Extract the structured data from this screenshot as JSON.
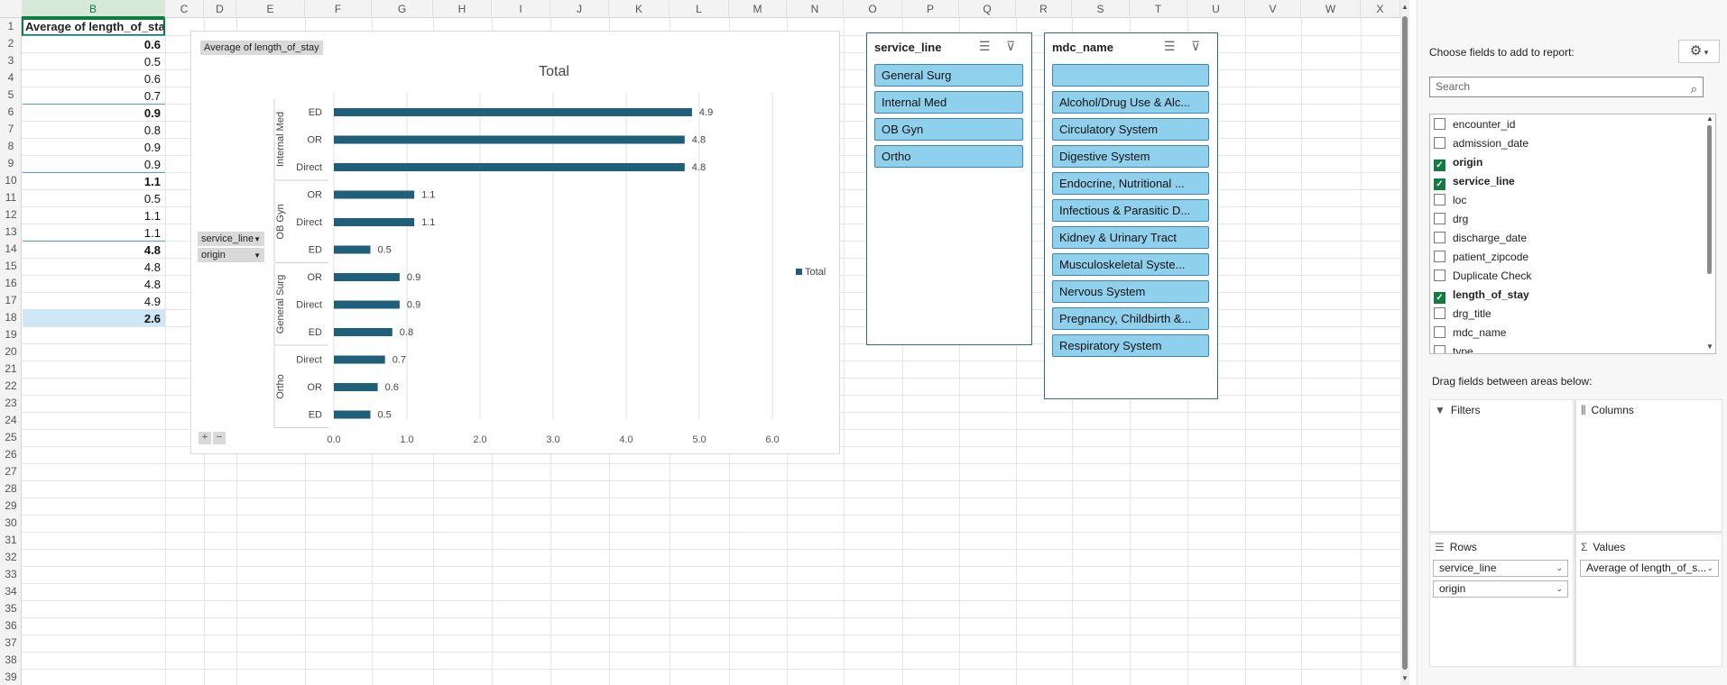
{
  "columns": [
    "B",
    "C",
    "D",
    "E",
    "F",
    "G",
    "H",
    "I",
    "J",
    "K",
    "L",
    "M",
    "N",
    "O",
    "P",
    "Q",
    "R",
    "S",
    "T",
    "U",
    "V",
    "W",
    "X"
  ],
  "rows": [
    "1",
    "2",
    "3",
    "4",
    "5",
    "6",
    "7",
    "8",
    "9",
    "10",
    "11",
    "12",
    "13",
    "14",
    "15",
    "16",
    "17",
    "18",
    "19",
    "20",
    "21",
    "22",
    "23",
    "24",
    "25",
    "26",
    "27",
    "28",
    "29",
    "30",
    "31",
    "32",
    "33",
    "34",
    "35",
    "36",
    "37",
    "38",
    "39"
  ],
  "pivot": {
    "header": "Average of length_of_stay",
    "values": [
      {
        "v": "0.6",
        "bold": true
      },
      {
        "v": "0.5",
        "bold": false
      },
      {
        "v": "0.6",
        "bold": false
      },
      {
        "v": "0.7",
        "bold": false
      },
      {
        "v": "0.9",
        "bold": true
      },
      {
        "v": "0.8",
        "bold": false
      },
      {
        "v": "0.9",
        "bold": false
      },
      {
        "v": "0.9",
        "bold": false
      },
      {
        "v": "1.1",
        "bold": true
      },
      {
        "v": "0.5",
        "bold": false
      },
      {
        "v": "1.1",
        "bold": false
      },
      {
        "v": "1.1",
        "bold": false
      },
      {
        "v": "4.8",
        "bold": true
      },
      {
        "v": "4.8",
        "bold": false
      },
      {
        "v": "4.8",
        "bold": false
      },
      {
        "v": "4.9",
        "bold": false
      },
      {
        "v": "2.6",
        "bold": true
      }
    ]
  },
  "chart": {
    "field_button": "Average of length_of_stay",
    "row_fields": [
      "service_line",
      "origin"
    ],
    "plus": "+",
    "minus": "−"
  },
  "chart_data": {
    "type": "bar",
    "orientation": "horizontal",
    "title": "Total",
    "groups": [
      {
        "name": "Internal Med",
        "items": [
          {
            "label": "ED",
            "value": 4.9
          },
          {
            "label": "OR",
            "value": 4.8
          },
          {
            "label": "Direct",
            "value": 4.8
          }
        ]
      },
      {
        "name": "OB Gyn",
        "items": [
          {
            "label": "OR",
            "value": 1.1
          },
          {
            "label": "Direct",
            "value": 1.1
          },
          {
            "label": "ED",
            "value": 0.5
          }
        ]
      },
      {
        "name": "General Surg",
        "items": [
          {
            "label": "OR",
            "value": 0.9
          },
          {
            "label": "Direct",
            "value": 0.9
          },
          {
            "label": "ED",
            "value": 0.8
          }
        ]
      },
      {
        "name": "Ortho",
        "items": [
          {
            "label": "Direct",
            "value": 0.7
          },
          {
            "label": "OR",
            "value": 0.6
          },
          {
            "label": "ED",
            "value": 0.5
          }
        ]
      }
    ],
    "xticks": [
      "0.0",
      "1.0",
      "2.0",
      "3.0",
      "4.0",
      "5.0",
      "6.0"
    ],
    "xlim": [
      0,
      6.5
    ],
    "legend": {
      "label": "Total",
      "position": "right"
    },
    "bar_color": "#1f5f7a",
    "grid": true
  },
  "slicer_service": {
    "title": "service_line",
    "items": [
      "General Surg",
      "Internal Med",
      "OB Gyn",
      "Ortho"
    ]
  },
  "slicer_mdc": {
    "title": "mdc_name",
    "items": [
      "",
      "Alcohol/Drug Use & Alc...",
      "Circulatory System",
      "Digestive System",
      "Endocrine, Nutritional ...",
      "Infectious & Parasitic D...",
      "Kidney & Urinary Tract",
      "Musculoskeletal Syste...",
      "Nervous System",
      "Pregnancy, Childbirth &...",
      "Respiratory System"
    ]
  },
  "pane": {
    "choose_label": "Choose fields to add to report:",
    "search_placeholder": "Search",
    "fields": [
      {
        "name": "encounter_id",
        "checked": false
      },
      {
        "name": "admission_date",
        "checked": false
      },
      {
        "name": "origin",
        "checked": true
      },
      {
        "name": "service_line",
        "checked": true
      },
      {
        "name": "loc",
        "checked": false
      },
      {
        "name": "drg",
        "checked": false
      },
      {
        "name": "discharge_date",
        "checked": false
      },
      {
        "name": "patient_zipcode",
        "checked": false
      },
      {
        "name": "Duplicate Check",
        "checked": false
      },
      {
        "name": "length_of_stay",
        "checked": true
      },
      {
        "name": "drg_title",
        "checked": false
      },
      {
        "name": "mdc_name",
        "checked": false
      },
      {
        "name": "type",
        "checked": false
      }
    ],
    "drag_label": "Drag fields between areas below:",
    "filters_label": "Filters",
    "columns_label": "Columns",
    "rows_label": "Rows",
    "values_label": "Values",
    "rows_items": [
      "service_line",
      "origin"
    ],
    "values_items": [
      "Average of length_of_s..."
    ]
  }
}
